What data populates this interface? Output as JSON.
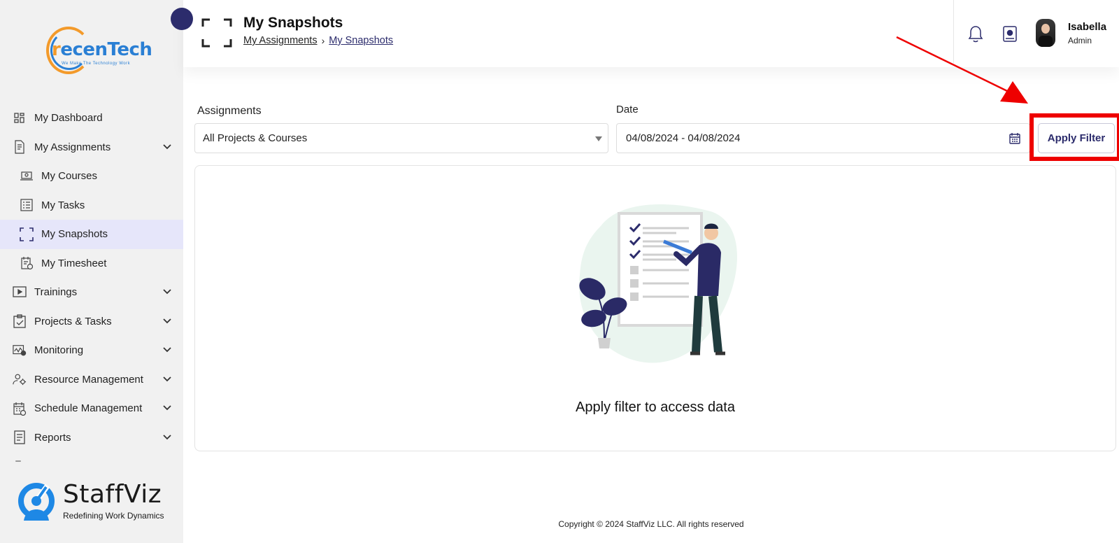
{
  "brand": {
    "logo_word_part1": "r",
    "logo_word_part2": "ecen",
    "logo_word_part3": "Tech",
    "logo_tagline": "We Make The Technology Work"
  },
  "sidebar": {
    "items": [
      {
        "label": "My Dashboard",
        "icon": "dashboard-icon",
        "expandable": false
      },
      {
        "label": "My Assignments",
        "icon": "assignments-icon",
        "expandable": true
      },
      {
        "label": "My Courses",
        "icon": "courses-icon",
        "expandable": false,
        "sub": true
      },
      {
        "label": "My Tasks",
        "icon": "tasks-icon",
        "expandable": false,
        "sub": true
      },
      {
        "label": "My Snapshots",
        "icon": "snapshot-icon",
        "expandable": false,
        "sub": true,
        "active": true
      },
      {
        "label": "My Timesheet",
        "icon": "timesheet-icon",
        "expandable": false,
        "sub": true
      },
      {
        "label": "Trainings",
        "icon": "play-icon",
        "expandable": true
      },
      {
        "label": "Projects & Tasks",
        "icon": "clipboard-icon",
        "expandable": true
      },
      {
        "label": "Monitoring",
        "icon": "monitoring-icon",
        "expandable": true
      },
      {
        "label": "Resource Management",
        "icon": "user-gear-icon",
        "expandable": true
      },
      {
        "label": "Schedule Management",
        "icon": "schedule-icon",
        "expandable": true
      },
      {
        "label": "Reports",
        "icon": "report-icon",
        "expandable": true
      }
    ],
    "footer_logo": {
      "name": "StaffViz",
      "tagline": "Redefining Work Dynamics"
    }
  },
  "header": {
    "title": "My Snapshots",
    "breadcrumb": [
      "My Assignments",
      "My Snapshots"
    ],
    "user": {
      "name": "Isabella",
      "role": "Admin"
    }
  },
  "filters": {
    "assignments_label": "Assignments",
    "assignments_value": "All Projects & Courses",
    "date_label": "Date",
    "date_value": "04/08/2024 - 04/08/2024",
    "apply_label": "Apply Filter"
  },
  "empty_state": {
    "message": "Apply filter to access data"
  },
  "footer": {
    "copyright": "Copyright © 2024 StaffViz LLC. All rights reserved"
  },
  "colors": {
    "primary": "#2c2c6c",
    "active_bg": "#e6e6fa",
    "highlight": "#ee0000",
    "sidebar_bg": "#f1f1f1"
  }
}
